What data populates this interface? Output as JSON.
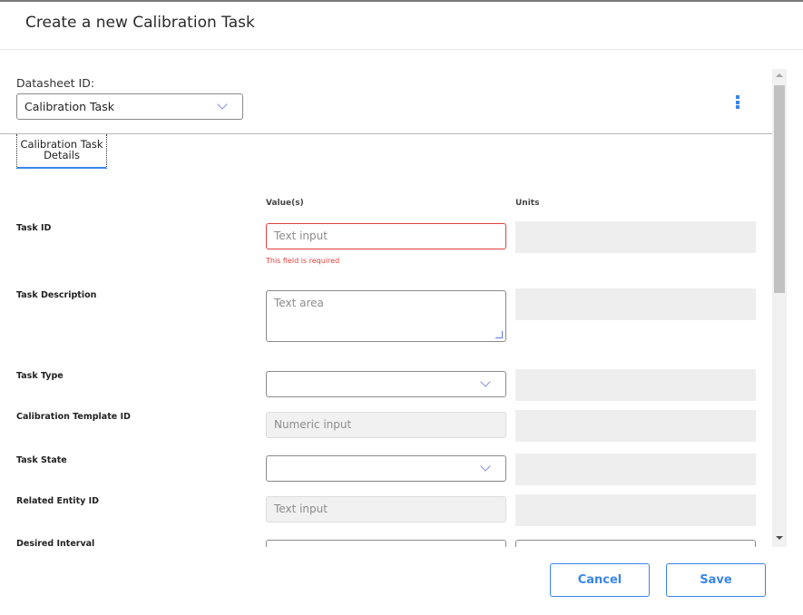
{
  "dialog": {
    "title": "Create a new Calibration Task"
  },
  "datasheet": {
    "label": "Datasheet ID:",
    "selected": "Calibration Task"
  },
  "tabs": [
    {
      "label": "Calibration Task Details",
      "active": true
    }
  ],
  "columns": {
    "values": "Value(s)",
    "units": "Units"
  },
  "fields": [
    {
      "label": "Task ID",
      "type": "text",
      "placeholder": "Text input",
      "required": true,
      "error": "This field is required"
    },
    {
      "label": "Task Description",
      "type": "textarea",
      "placeholder": "Text area"
    },
    {
      "label": "Task Type",
      "type": "select",
      "value": ""
    },
    {
      "label": "Calibration Template ID",
      "type": "numeric",
      "placeholder": "Numeric input",
      "disabled": true
    },
    {
      "label": "Task State",
      "type": "select",
      "value": ""
    },
    {
      "label": "Related Entity ID",
      "type": "text",
      "placeholder": "Text input",
      "disabled": true
    },
    {
      "label": "Desired Interval",
      "type": "text",
      "placeholder": ""
    }
  ],
  "actions": {
    "cancel": "Cancel",
    "save": "Save"
  },
  "colors": {
    "accent": "#3a86e8",
    "error": "#e0403a"
  }
}
